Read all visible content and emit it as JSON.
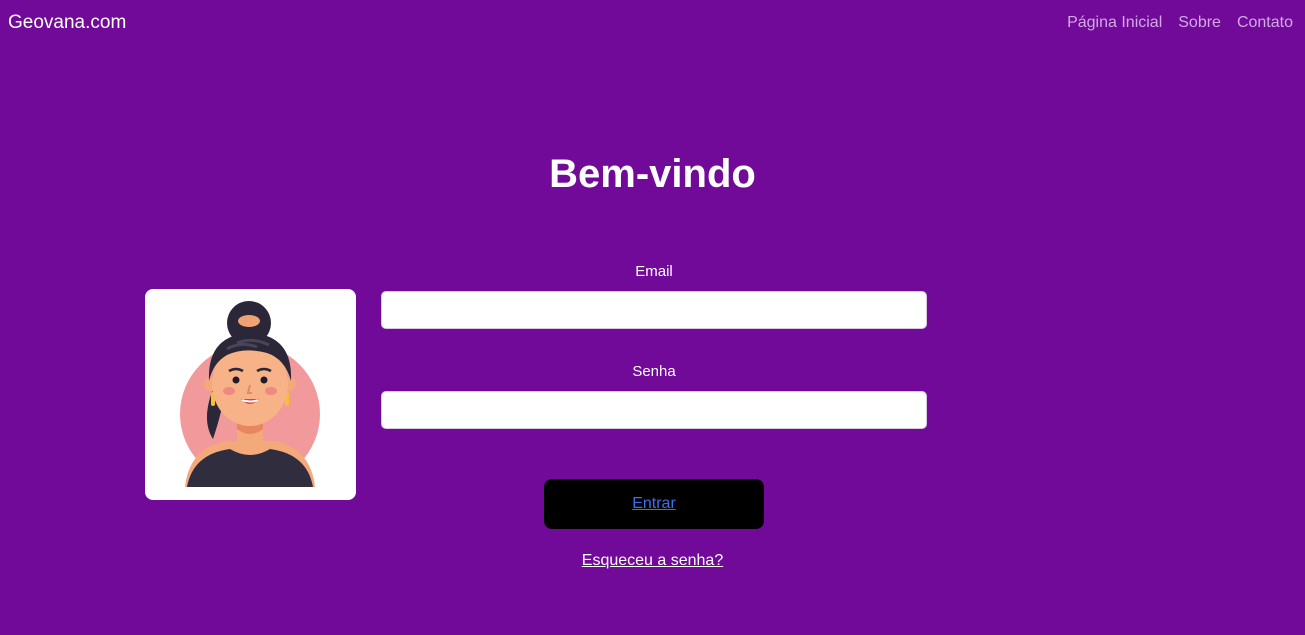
{
  "navbar": {
    "brand": "Geovana.com",
    "links": [
      "Página Inicial",
      "Sobre",
      "Contato"
    ]
  },
  "main": {
    "title": "Bem-vindo",
    "email_label": "Email",
    "email_value": "",
    "password_label": "Senha",
    "password_value": "",
    "login_button": "Entrar",
    "forgot_link": "Esqueceu a senha?"
  },
  "avatar": {
    "icon": "woman-avatar-illustration"
  },
  "colors": {
    "background": "#710a99",
    "nav_link": "#d2a9e4",
    "button_bg": "#000000",
    "button_link": "#3d6ef0",
    "card_bg": "#ffffff"
  }
}
